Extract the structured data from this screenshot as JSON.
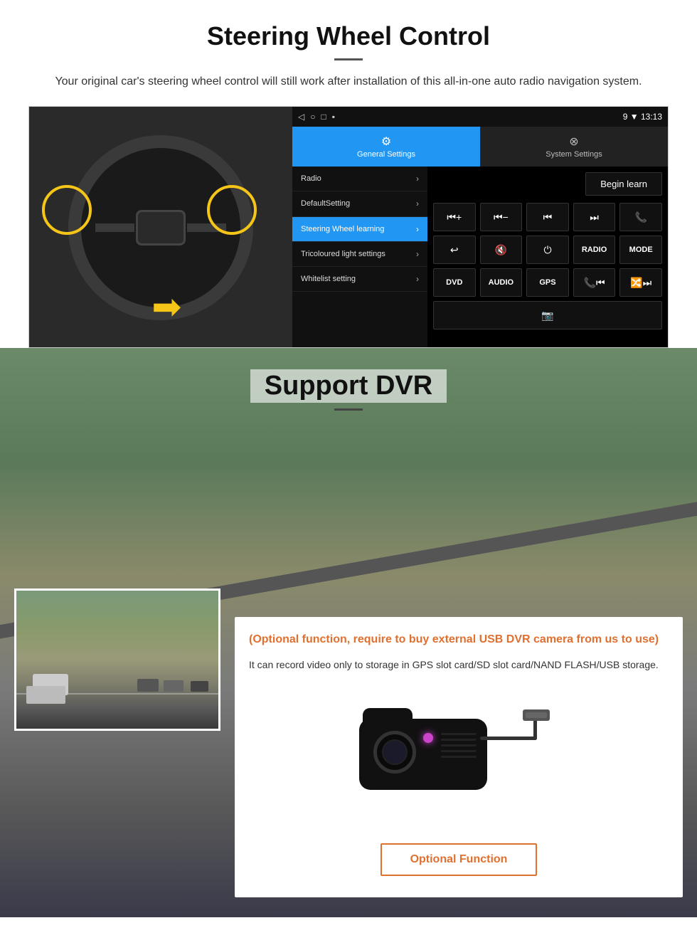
{
  "section1": {
    "title": "Steering Wheel Control",
    "subtitle": "Your original car's steering wheel control will still work after installation of this all-in-one auto radio navigation system.",
    "android_topbar": {
      "icons": [
        "◁",
        "○",
        "□",
        "▪"
      ],
      "status": "9 ▼ 13:13"
    },
    "tabs": [
      {
        "id": "general",
        "label": "General Settings",
        "icon": "⚙",
        "active": true
      },
      {
        "id": "system",
        "label": "System Settings",
        "icon": "⊗",
        "active": false
      }
    ],
    "menu_items": [
      {
        "label": "Radio",
        "active": false
      },
      {
        "label": "DefaultSetting",
        "active": false
      },
      {
        "label": "Steering Wheel learning",
        "active": true
      },
      {
        "label": "Tricoloured light settings",
        "active": false
      },
      {
        "label": "Whitelist setting",
        "active": false
      }
    ],
    "begin_learn_label": "Begin learn",
    "control_buttons_row1": [
      "⏮+",
      "⏮-",
      "⏮",
      "⏭",
      "📞"
    ],
    "control_buttons_row2": [
      "↩",
      "🔇",
      "⏻",
      "RADIO",
      "MODE"
    ],
    "control_buttons_row3": [
      "DVD",
      "AUDIO",
      "GPS",
      "📞⏮",
      "🔀⏭"
    ],
    "control_buttons_row4": [
      "📷"
    ]
  },
  "section2": {
    "title": "Support DVR",
    "optional_text": "(Optional function, require to buy external USB DVR camera from us to use)",
    "desc_text": "It can record video only to storage in GPS slot card/SD slot card/NAND FLASH/USB storage.",
    "optional_function_label": "Optional Function"
  }
}
